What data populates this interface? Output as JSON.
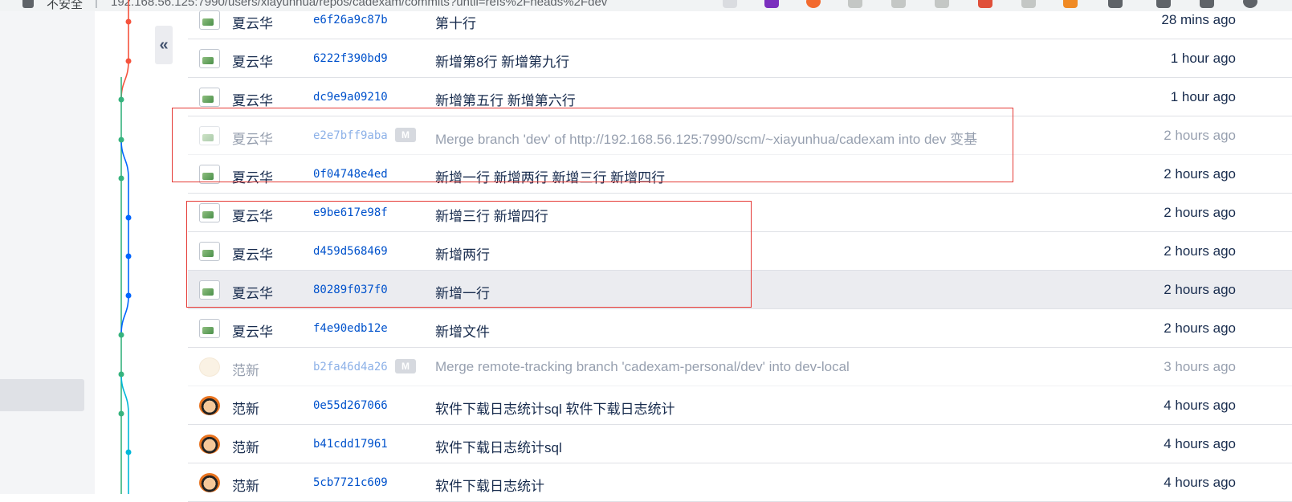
{
  "browser": {
    "label": "不安全",
    "url": "192.168.56.125:7990/users/xiayunhua/repos/cadexam/commits?until=refs%2Fheads%2Fdev"
  },
  "collapse_label": "«",
  "merge_badge": "M",
  "commits": [
    {
      "author": "夏云华",
      "hash": "e6f26a9c87b",
      "message": "第十行",
      "time": "28 mins ago",
      "avatar": "broken",
      "merge": false,
      "dim": false
    },
    {
      "author": "夏云华",
      "hash": "6222f390bd9",
      "message": "新增第8行 新增第九行",
      "time": "1 hour ago",
      "avatar": "broken",
      "merge": false,
      "dim": false
    },
    {
      "author": "夏云华",
      "hash": "dc9e9a09210",
      "message": "新增第五行 新增第六行",
      "time": "1 hour ago",
      "avatar": "broken",
      "merge": false,
      "dim": false
    },
    {
      "author": "夏云华",
      "hash": "e2e7bff9aba",
      "message": "Merge branch 'dev' of http://192.168.56.125:7990/scm/~xiayunhua/cadexam into dev 变基",
      "time": "2 hours ago",
      "avatar": "broken",
      "merge": true,
      "dim": true
    },
    {
      "author": "夏云华",
      "hash": "0f04748e4ed",
      "message": "新增一行 新增两行 新增三行 新增四行",
      "time": "2 hours ago",
      "avatar": "broken",
      "merge": false,
      "dim": false
    },
    {
      "author": "夏云华",
      "hash": "e9be617e98f",
      "message": "新增三行 新增四行",
      "time": "2 hours ago",
      "avatar": "broken",
      "merge": false,
      "dim": false
    },
    {
      "author": "夏云华",
      "hash": "d459d568469",
      "message": "新增两行",
      "time": "2 hours ago",
      "avatar": "broken",
      "merge": false,
      "dim": false
    },
    {
      "author": "夏云华",
      "hash": "80289f037f0",
      "message": "新增一行",
      "time": "2 hours ago",
      "avatar": "broken",
      "merge": false,
      "dim": false,
      "highlight": true
    },
    {
      "author": "夏云华",
      "hash": "f4e90edb12e",
      "message": "新增文件",
      "time": "2 hours ago",
      "avatar": "broken",
      "merge": false,
      "dim": false
    },
    {
      "author": "范新",
      "hash": "b2fa46d4a26",
      "message": "Merge remote-tracking branch 'cadexam-personal/dev' into dev-local",
      "time": "3 hours ago",
      "avatar": "beige",
      "merge": true,
      "dim": true
    },
    {
      "author": "范新",
      "hash": "0e55d267066",
      "message": "软件下载日志统计sql 软件下载日志统计",
      "time": "4 hours ago",
      "avatar": "face",
      "merge": false,
      "dim": false
    },
    {
      "author": "范新",
      "hash": "b41cdd17961",
      "message": "软件下载日志统计sql",
      "time": "4 hours ago",
      "avatar": "face",
      "merge": false,
      "dim": false
    },
    {
      "author": "范新",
      "hash": "5cb7721c609",
      "message": "软件下载日志统计",
      "time": "4 hours ago",
      "avatar": "face",
      "merge": false,
      "dim": false
    }
  ],
  "graph_colors": {
    "red": "#f5533d",
    "green": "#36b37e",
    "blue": "#0065ff",
    "cyan": "#00b8d9"
  }
}
